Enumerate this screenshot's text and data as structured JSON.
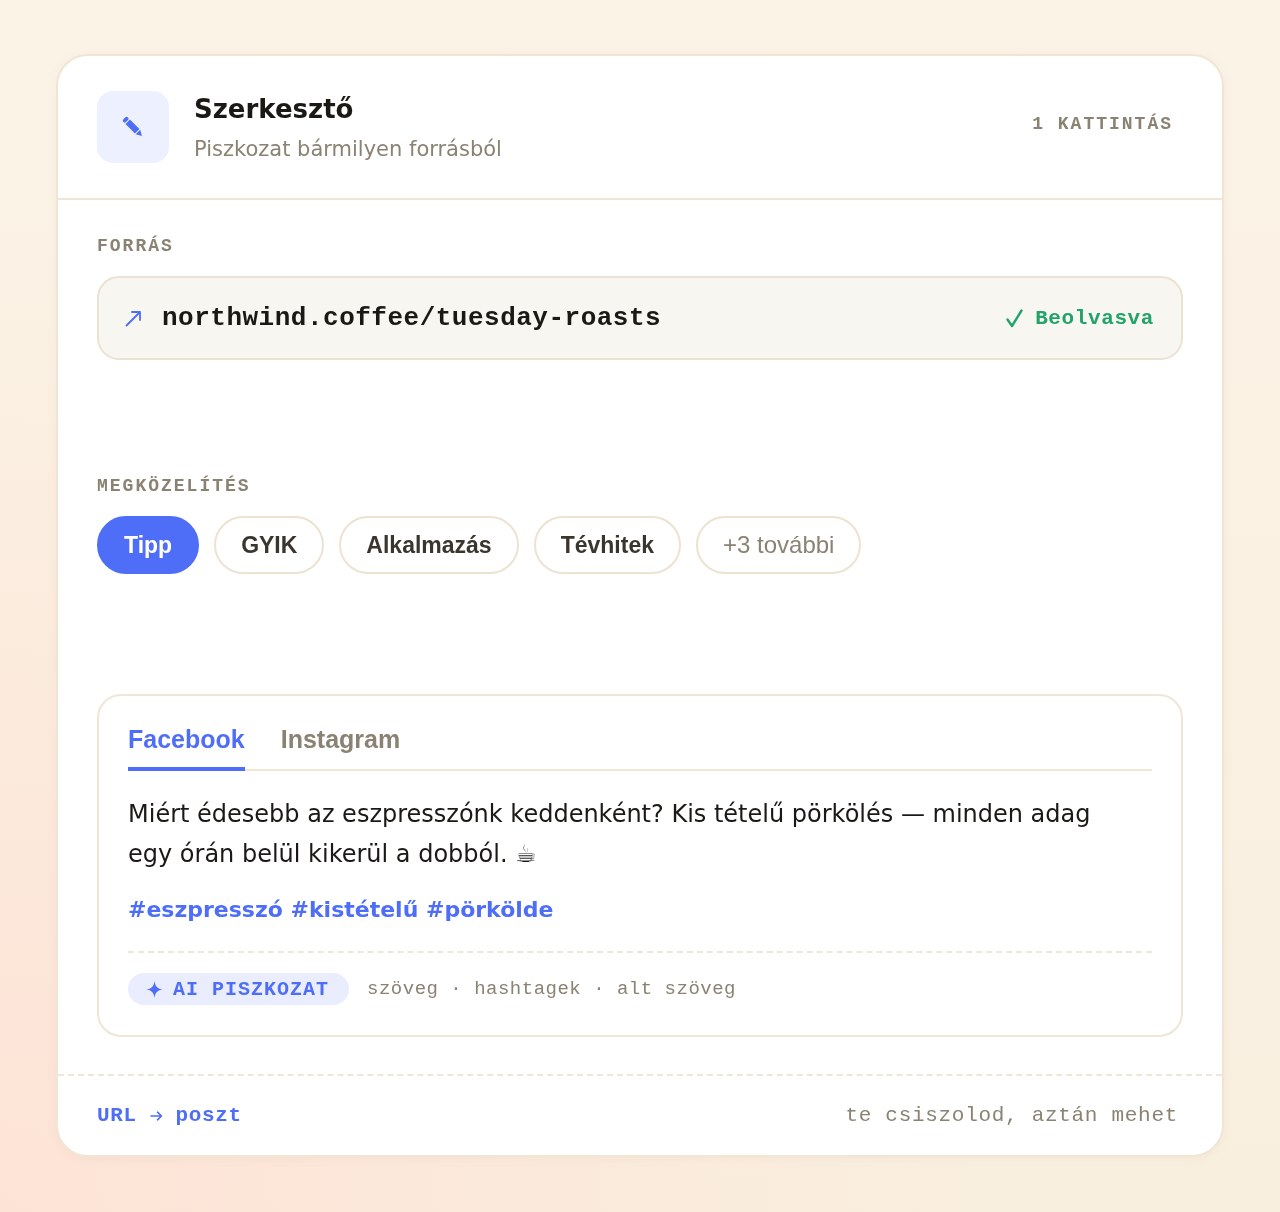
{
  "header": {
    "title": "Szerkesztő",
    "subtitle": "Piszkozat bármilyen forrásból",
    "badge": "1 KATTINTÁS"
  },
  "source": {
    "label": "FORRÁS",
    "url": "northwind.coffee/tuesday-roasts",
    "status": "Beolvasva"
  },
  "approach": {
    "label": "MEGKÖZELÍTÉS",
    "options": [
      {
        "label": "Tipp",
        "kind": "option",
        "selected": true
      },
      {
        "label": "GYIK",
        "kind": "option",
        "selected": false
      },
      {
        "label": "Alkalmazás",
        "kind": "option",
        "selected": false
      },
      {
        "label": "Tévhitek",
        "kind": "option",
        "selected": false
      },
      {
        "label": "+3 további",
        "kind": "more",
        "selected": false
      }
    ]
  },
  "preview": {
    "tabs": [
      {
        "label": "Facebook",
        "selected": true
      },
      {
        "label": "Instagram",
        "selected": false
      }
    ],
    "post_text": "Miért édesebb az eszpresszónk keddenként? Kis tételű pörkölés — minden adag egy órán belül kikerül a dobból. ☕",
    "hashtags": "#eszpresszó #kistételű #pörkölde",
    "ai_badge": "AI PISZKOZAT",
    "includes": "szöveg · hashtagek · alt szöveg"
  },
  "footer": {
    "from": "URL",
    "to": "poszt",
    "note": "te csiszolod, aztán mehet"
  }
}
